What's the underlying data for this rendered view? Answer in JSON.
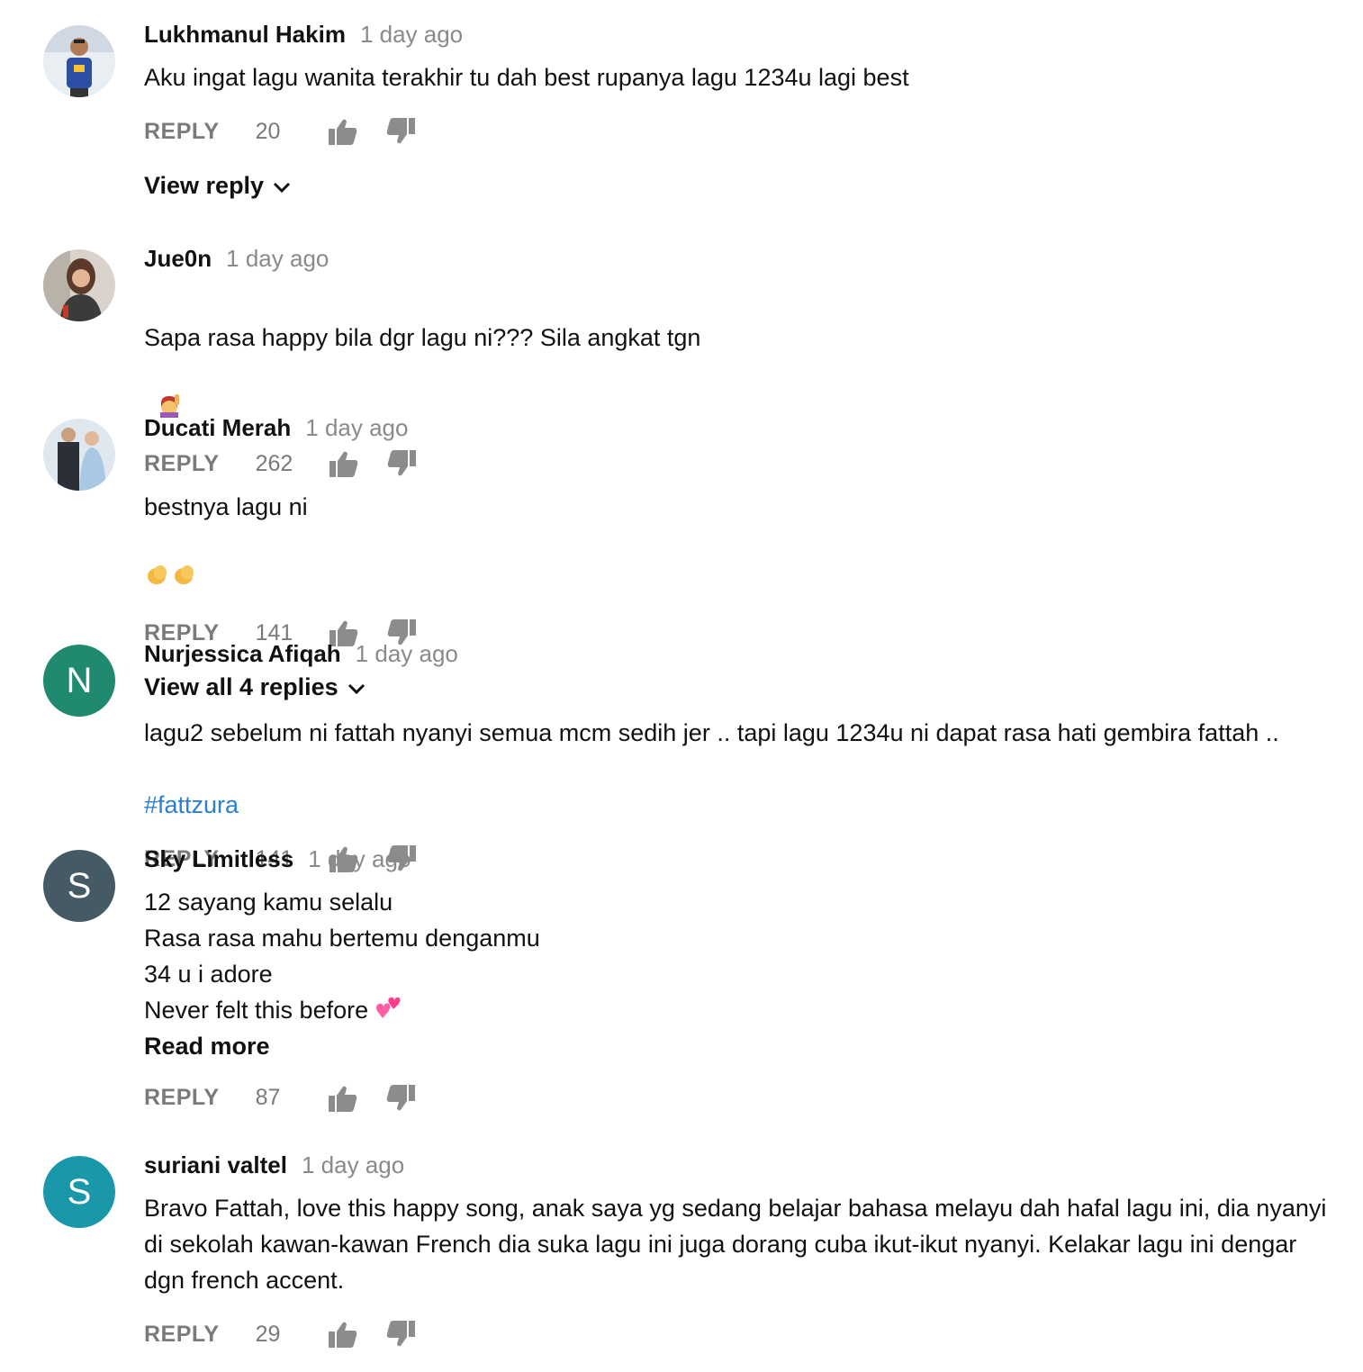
{
  "comments": [
    {
      "author": "Lukhmanul Hakim",
      "time": "1 day ago",
      "text": "Aku ingat lagu wanita terakhir tu dah best rupanya lagu 1234u lagi best",
      "reply_label": "REPLY",
      "likes": "20",
      "view_replies": "View reply"
    },
    {
      "author": "Jue0n",
      "time": "1 day ago",
      "text": "Sapa rasa happy bila dgr lagu ni???  Sila angkat tgn",
      "emoji": "raising-hand-emoji",
      "reply_label": "REPLY",
      "likes": "262"
    },
    {
      "author": "Ducati Merah",
      "time": "1 day ago",
      "text": "bestnya lagu ni",
      "emoji": "clapping-hands-emoji",
      "reply_label": "REPLY",
      "likes": "141",
      "view_replies": "View all 4 replies"
    },
    {
      "author": "Nurjessica Afiqah",
      "time": "1 day ago",
      "avatar_letter": "N",
      "avatar_color": "#1f8a70",
      "text": "lagu2 sebelum ni fattah nyanyi semua mcm sedih jer .. tapi lagu 1234u ni dapat rasa hati gembira fattah ..",
      "hashtag": "#fattzura",
      "reply_label": "REPLY",
      "likes": "141"
    },
    {
      "author": "Sky Limitless",
      "time": "1 day ago",
      "avatar_letter": "S",
      "avatar_color": "#455a64",
      "text_lines": [
        "12 sayang kamu selalu",
        "Rasa rasa mahu bertemu denganmu",
        "34  u i adore",
        "Never felt this before"
      ],
      "emoji": "two-hearts-emoji",
      "read_more": "Read more",
      "reply_label": "REPLY",
      "likes": "87"
    },
    {
      "author": "suriani valtel",
      "time": "1 day ago",
      "avatar_letter": "S",
      "avatar_color": "#1a97a8",
      "text": "Bravo Fattah, love this happy song, anak saya yg sedang belajar bahasa melayu dah hafal lagu ini, dia nyanyi di sekolah kawan-kawan French dia suka lagu ini juga dorang cuba ikut-ikut nyanyi. Kelakar lagu ini dengar dgn french accent.",
      "reply_label": "REPLY",
      "likes": "29"
    }
  ],
  "icons": {
    "like": "thumb-up-icon",
    "dislike": "thumb-down-icon",
    "expand": "chevron-down-icon"
  },
  "colors": {
    "hashtag": "#2a7fd4",
    "meta": "#8a8a8a"
  }
}
